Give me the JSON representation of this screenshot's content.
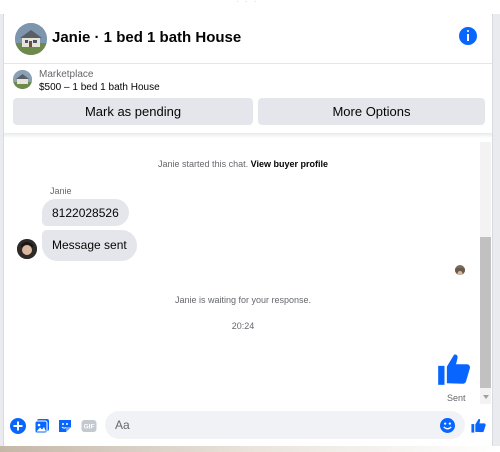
{
  "header": {
    "title": "Janie · 1 bed 1 bath House"
  },
  "listing": {
    "label": "Marketplace",
    "price_title": "$500 – 1 bed 1 bath House"
  },
  "actions": {
    "mark_pending": "Mark as pending",
    "more_options": "More Options"
  },
  "conversation": {
    "started_text": "Janie started this chat.",
    "view_profile": "View buyer profile",
    "sender_name": "Janie",
    "messages": [
      {
        "text": "8122028526"
      },
      {
        "text": "Message sent"
      }
    ],
    "waiting_text": "Janie is waiting for your response.",
    "timestamp": "20:24",
    "sent_status": "Sent"
  },
  "composer": {
    "placeholder": "Aa",
    "gif_label": "GIF"
  },
  "colors": {
    "accent": "#0866ff",
    "bubble_bg": "#e4e6eb",
    "button_bg": "#e4e6eb"
  },
  "icons": [
    "info-icon",
    "add-icon",
    "photo-icon",
    "sticker-icon",
    "gif-icon",
    "emoji-icon",
    "like-icon"
  ]
}
